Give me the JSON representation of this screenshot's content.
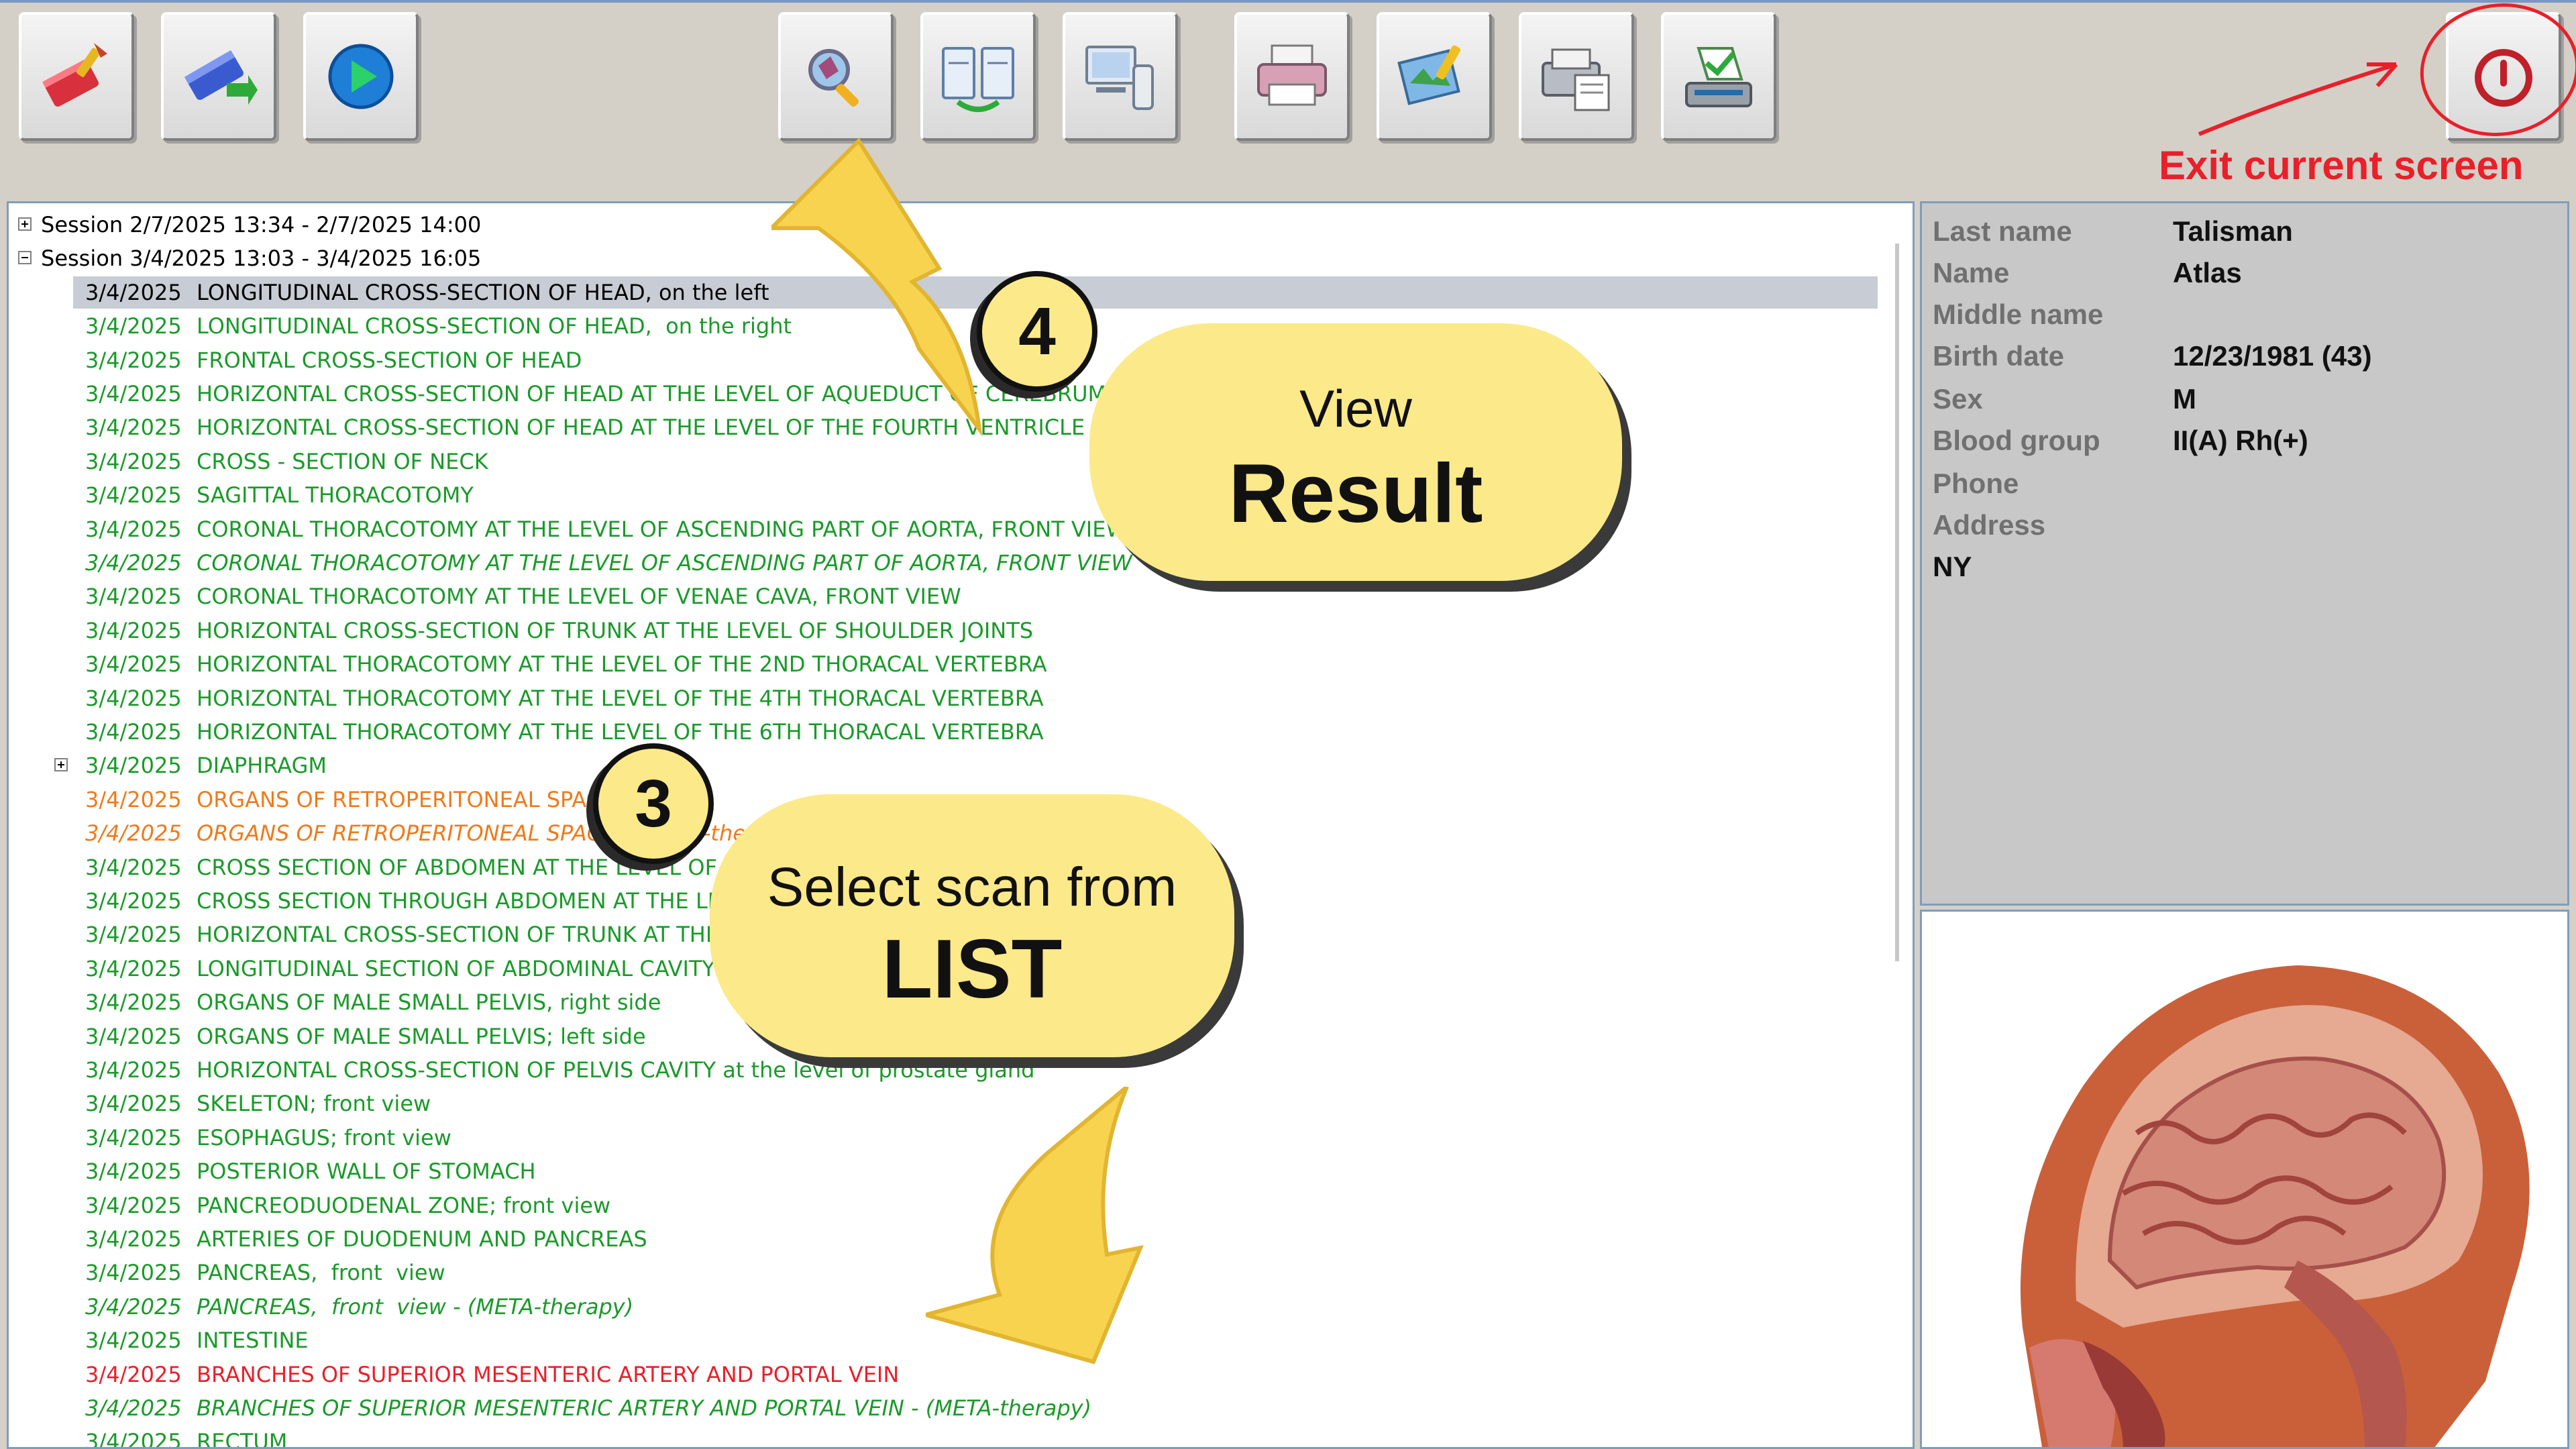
{
  "toolbar": {
    "buttons": [
      {
        "icon": "eraser-icon"
      },
      {
        "icon": "database-transfer-icon"
      },
      {
        "icon": "play-icon"
      },
      {
        "icon": "magnifier-icon"
      },
      {
        "icon": "compare-clipboards-icon"
      },
      {
        "icon": "computer-device-icon"
      },
      {
        "icon": "printer-icon"
      },
      {
        "icon": "edit-map-icon"
      },
      {
        "icon": "fax-icon"
      },
      {
        "icon": "scanner-icon"
      },
      {
        "icon": "power-icon"
      }
    ]
  },
  "tree": {
    "sessions": [
      {
        "label": "Session 2/7/2025 13:34 - 2/7/2025 14:00",
        "expanded": false
      },
      {
        "label": "Session 3/4/2025 13:03 - 3/4/2025 16:05",
        "expanded": true
      }
    ],
    "items": [
      {
        "date": "3/4/2025",
        "title": "LONGITUDINAL CROSS-SECTION OF HEAD, on the left",
        "color": "black",
        "italic": false,
        "selected": true
      },
      {
        "date": "3/4/2025",
        "title": "LONGITUDINAL CROSS-SECTION OF HEAD,  on the right",
        "color": "green",
        "italic": false
      },
      {
        "date": "3/4/2025",
        "title": "FRONTAL CROSS-SECTION OF HEAD",
        "color": "green",
        "italic": false
      },
      {
        "date": "3/4/2025",
        "title": "HORIZONTAL CROSS-SECTION OF HEAD AT THE LEVEL OF AQUEDUCT OF CEREBRUM",
        "color": "green",
        "italic": false
      },
      {
        "date": "3/4/2025",
        "title": "HORIZONTAL CROSS-SECTION OF HEAD AT THE LEVEL OF THE FOURTH VENTRICLE",
        "color": "green",
        "italic": false
      },
      {
        "date": "3/4/2025",
        "title": "CROSS - SECTION OF NECK",
        "color": "green",
        "italic": false
      },
      {
        "date": "3/4/2025",
        "title": "SAGITTAL THORACOTOMY",
        "color": "green",
        "italic": false
      },
      {
        "date": "3/4/2025",
        "title": "CORONAL THORACOTOMY AT THE LEVEL OF ASCENDING PART OF AORTA, FRONT VIEW",
        "color": "green",
        "italic": false
      },
      {
        "date": "3/4/2025",
        "title": "CORONAL THORACOTOMY AT THE LEVEL OF ASCENDING PART OF AORTA, FRONT VIEW",
        "color": "green",
        "italic": true
      },
      {
        "date": "3/4/2025",
        "title": "CORONAL THORACOTOMY AT THE LEVEL OF VENAE CAVA, FRONT VIEW",
        "color": "green",
        "italic": false
      },
      {
        "date": "3/4/2025",
        "title": "HORIZONTAL CROSS-SECTION OF TRUNK AT THE LEVEL OF SHOULDER JOINTS",
        "color": "green",
        "italic": false
      },
      {
        "date": "3/4/2025",
        "title": "HORIZONTAL THORACOTOMY AT THE LEVEL OF THE 2ND THORACAL VERTEBRA",
        "color": "green",
        "italic": false
      },
      {
        "date": "3/4/2025",
        "title": "HORIZONTAL THORACOTOMY AT THE LEVEL OF THE 4TH THORACAL VERTEBRA",
        "color": "green",
        "italic": false
      },
      {
        "date": "3/4/2025",
        "title": "HORIZONTAL THORACOTOMY AT THE LEVEL OF THE 6TH THORACAL VERTEBRA",
        "color": "green",
        "italic": false
      },
      {
        "date": "3/4/2025",
        "title": "DIAPHRAGM",
        "color": "green",
        "italic": false,
        "expander": true
      },
      {
        "date": "3/4/2025",
        "title": "ORGANS OF RETROPERITONEAL SPACE",
        "color": "orange",
        "italic": false
      },
      {
        "date": "3/4/2025",
        "title": "ORGANS OF RETROPERITONEAL SPACE - (META-therapy)",
        "color": "orange",
        "italic": true
      },
      {
        "date": "3/4/2025",
        "title": "CROSS SECTION OF ABDOMEN AT THE LEVEL OF",
        "color": "green",
        "italic": false
      },
      {
        "date": "3/4/2025",
        "title": "CROSS SECTION THROUGH ABDOMEN AT THE LEVEL",
        "color": "green",
        "italic": false
      },
      {
        "date": "3/4/2025",
        "title": "HORIZONTAL CROSS-SECTION OF TRUNK AT THE LEVEL",
        "color": "green",
        "italic": false
      },
      {
        "date": "3/4/2025",
        "title": "LONGITUDINAL SECTION OF ABDOMINAL CAVITY",
        "color": "green",
        "italic": false
      },
      {
        "date": "3/4/2025",
        "title": "ORGANS OF MALE SMALL PELVIS, right side",
        "color": "green",
        "italic": false
      },
      {
        "date": "3/4/2025",
        "title": "ORGANS OF MALE SMALL PELVIS; left side",
        "color": "green",
        "italic": false
      },
      {
        "date": "3/4/2025",
        "title": "HORIZONTAL CROSS-SECTION OF PELVIS CAVITY at the level of prostate gland",
        "color": "green",
        "italic": false
      },
      {
        "date": "3/4/2025",
        "title": "SKELETON; front view",
        "color": "green",
        "italic": false
      },
      {
        "date": "3/4/2025",
        "title": "ESOPHAGUS; front view",
        "color": "green",
        "italic": false
      },
      {
        "date": "3/4/2025",
        "title": "POSTERIOR WALL OF STOMACH",
        "color": "green",
        "italic": false
      },
      {
        "date": "3/4/2025",
        "title": "PANCREODUODENAL ZONE; front view",
        "color": "green",
        "italic": false
      },
      {
        "date": "3/4/2025",
        "title": "ARTERIES OF DUODENUM AND PANCREAS",
        "color": "green",
        "italic": false
      },
      {
        "date": "3/4/2025",
        "title": "PANCREAS,  front  view",
        "color": "green",
        "italic": false
      },
      {
        "date": "3/4/2025",
        "title": "PANCREAS,  front  view - (META-therapy)",
        "color": "green",
        "italic": true
      },
      {
        "date": "3/4/2025",
        "title": "INTESTINE",
        "color": "green",
        "italic": false
      },
      {
        "date": "3/4/2025",
        "title": "BRANCHES OF SUPERIOR MESENTERIC ARTERY AND PORTAL VEIN",
        "color": "red",
        "italic": false
      },
      {
        "date": "3/4/2025",
        "title": "BRANCHES OF SUPERIOR MESENTERIC ARTERY AND PORTAL VEIN - (META-therapy)",
        "color": "green",
        "italic": true
      },
      {
        "date": "3/4/2025",
        "title": "RECTUM",
        "color": "green",
        "italic": false
      }
    ]
  },
  "patient": [
    {
      "label": "Last name",
      "value": "Talisman"
    },
    {
      "label": "Name",
      "value": "Atlas"
    },
    {
      "label": "Middle name",
      "value": ""
    },
    {
      "label": "Birth date",
      "value": "12/23/1981 (43)"
    },
    {
      "label": "Sex",
      "value": "M"
    },
    {
      "label": "Blood group",
      "value": "II(A)  Rh(+)"
    },
    {
      "label": "Phone",
      "value": ""
    },
    {
      "label": "Address",
      "value": ""
    },
    {
      "label": "",
      "value": "NY"
    }
  ],
  "callouts": {
    "view": {
      "line1": "View",
      "line2": "Result",
      "step": "4"
    },
    "select": {
      "line1": "Select scan from",
      "line2": "LIST",
      "step": "3"
    }
  },
  "exit_label": "Exit current screen",
  "colors": {
    "green": "#1a9a2a",
    "orange": "#f07a1a",
    "red": "#e8202a",
    "black": "#000000",
    "callout": "#fce98a"
  }
}
